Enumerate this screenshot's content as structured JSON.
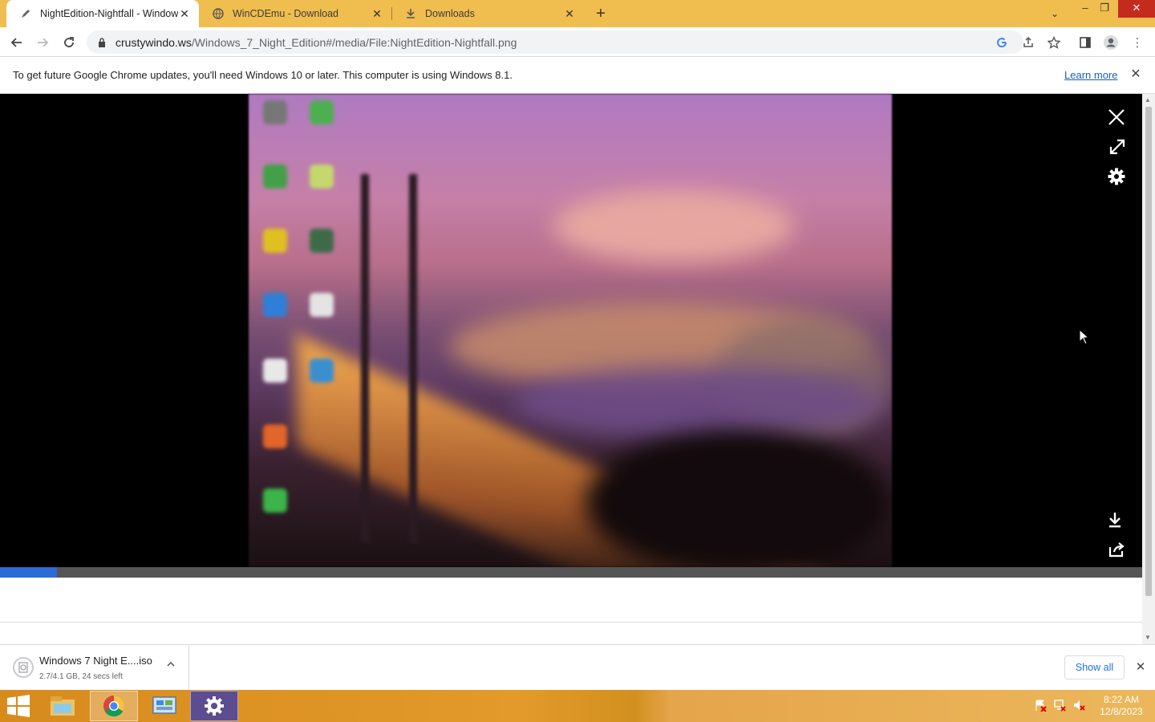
{
  "browser": {
    "tabs": [
      {
        "title": "NightEdition-Nightfall - Window",
        "active": true,
        "icon": "pen-favicon-icon"
      },
      {
        "title": "WinCDEmu - Download",
        "active": false,
        "icon": "globe-icon"
      },
      {
        "title": "Downloads",
        "active": false,
        "icon": "download-icon"
      }
    ],
    "url": {
      "host": "crustywindo.ws",
      "path": "/Windows_7_Night_Edition#/media/File:NightEdition-Nightfall.png"
    }
  },
  "infobar": {
    "message": "To get future Google Chrome updates, you'll need Windows 10 or later. This computer is using Windows 8.1.",
    "learn_more": "Learn more"
  },
  "viewer": {
    "image_name": "NightEdition-Nightfall.png",
    "load_progress": 0.05,
    "buttons": [
      "close-icon",
      "expand-icon",
      "gear-icon",
      "download-icon",
      "share-icon"
    ]
  },
  "download_shelf": {
    "item_name": "Windows 7 Night E....iso",
    "item_status": "2.7/4.1 GB, 24 secs left",
    "show_all": "Show all"
  },
  "taskbar": {
    "apps": [
      "file-explorer-icon",
      "chrome-icon",
      "control-panel-icon",
      "settings-gear-icon"
    ],
    "active_app": "chrome-icon",
    "time": "8:22 AM",
    "date": "12/8/2023"
  },
  "colors": {
    "tab_strip": "#f0bd4f",
    "progress_fill": "#2b6bd6",
    "taskbar": "#e39a2a",
    "link": "#1a5fb4"
  }
}
